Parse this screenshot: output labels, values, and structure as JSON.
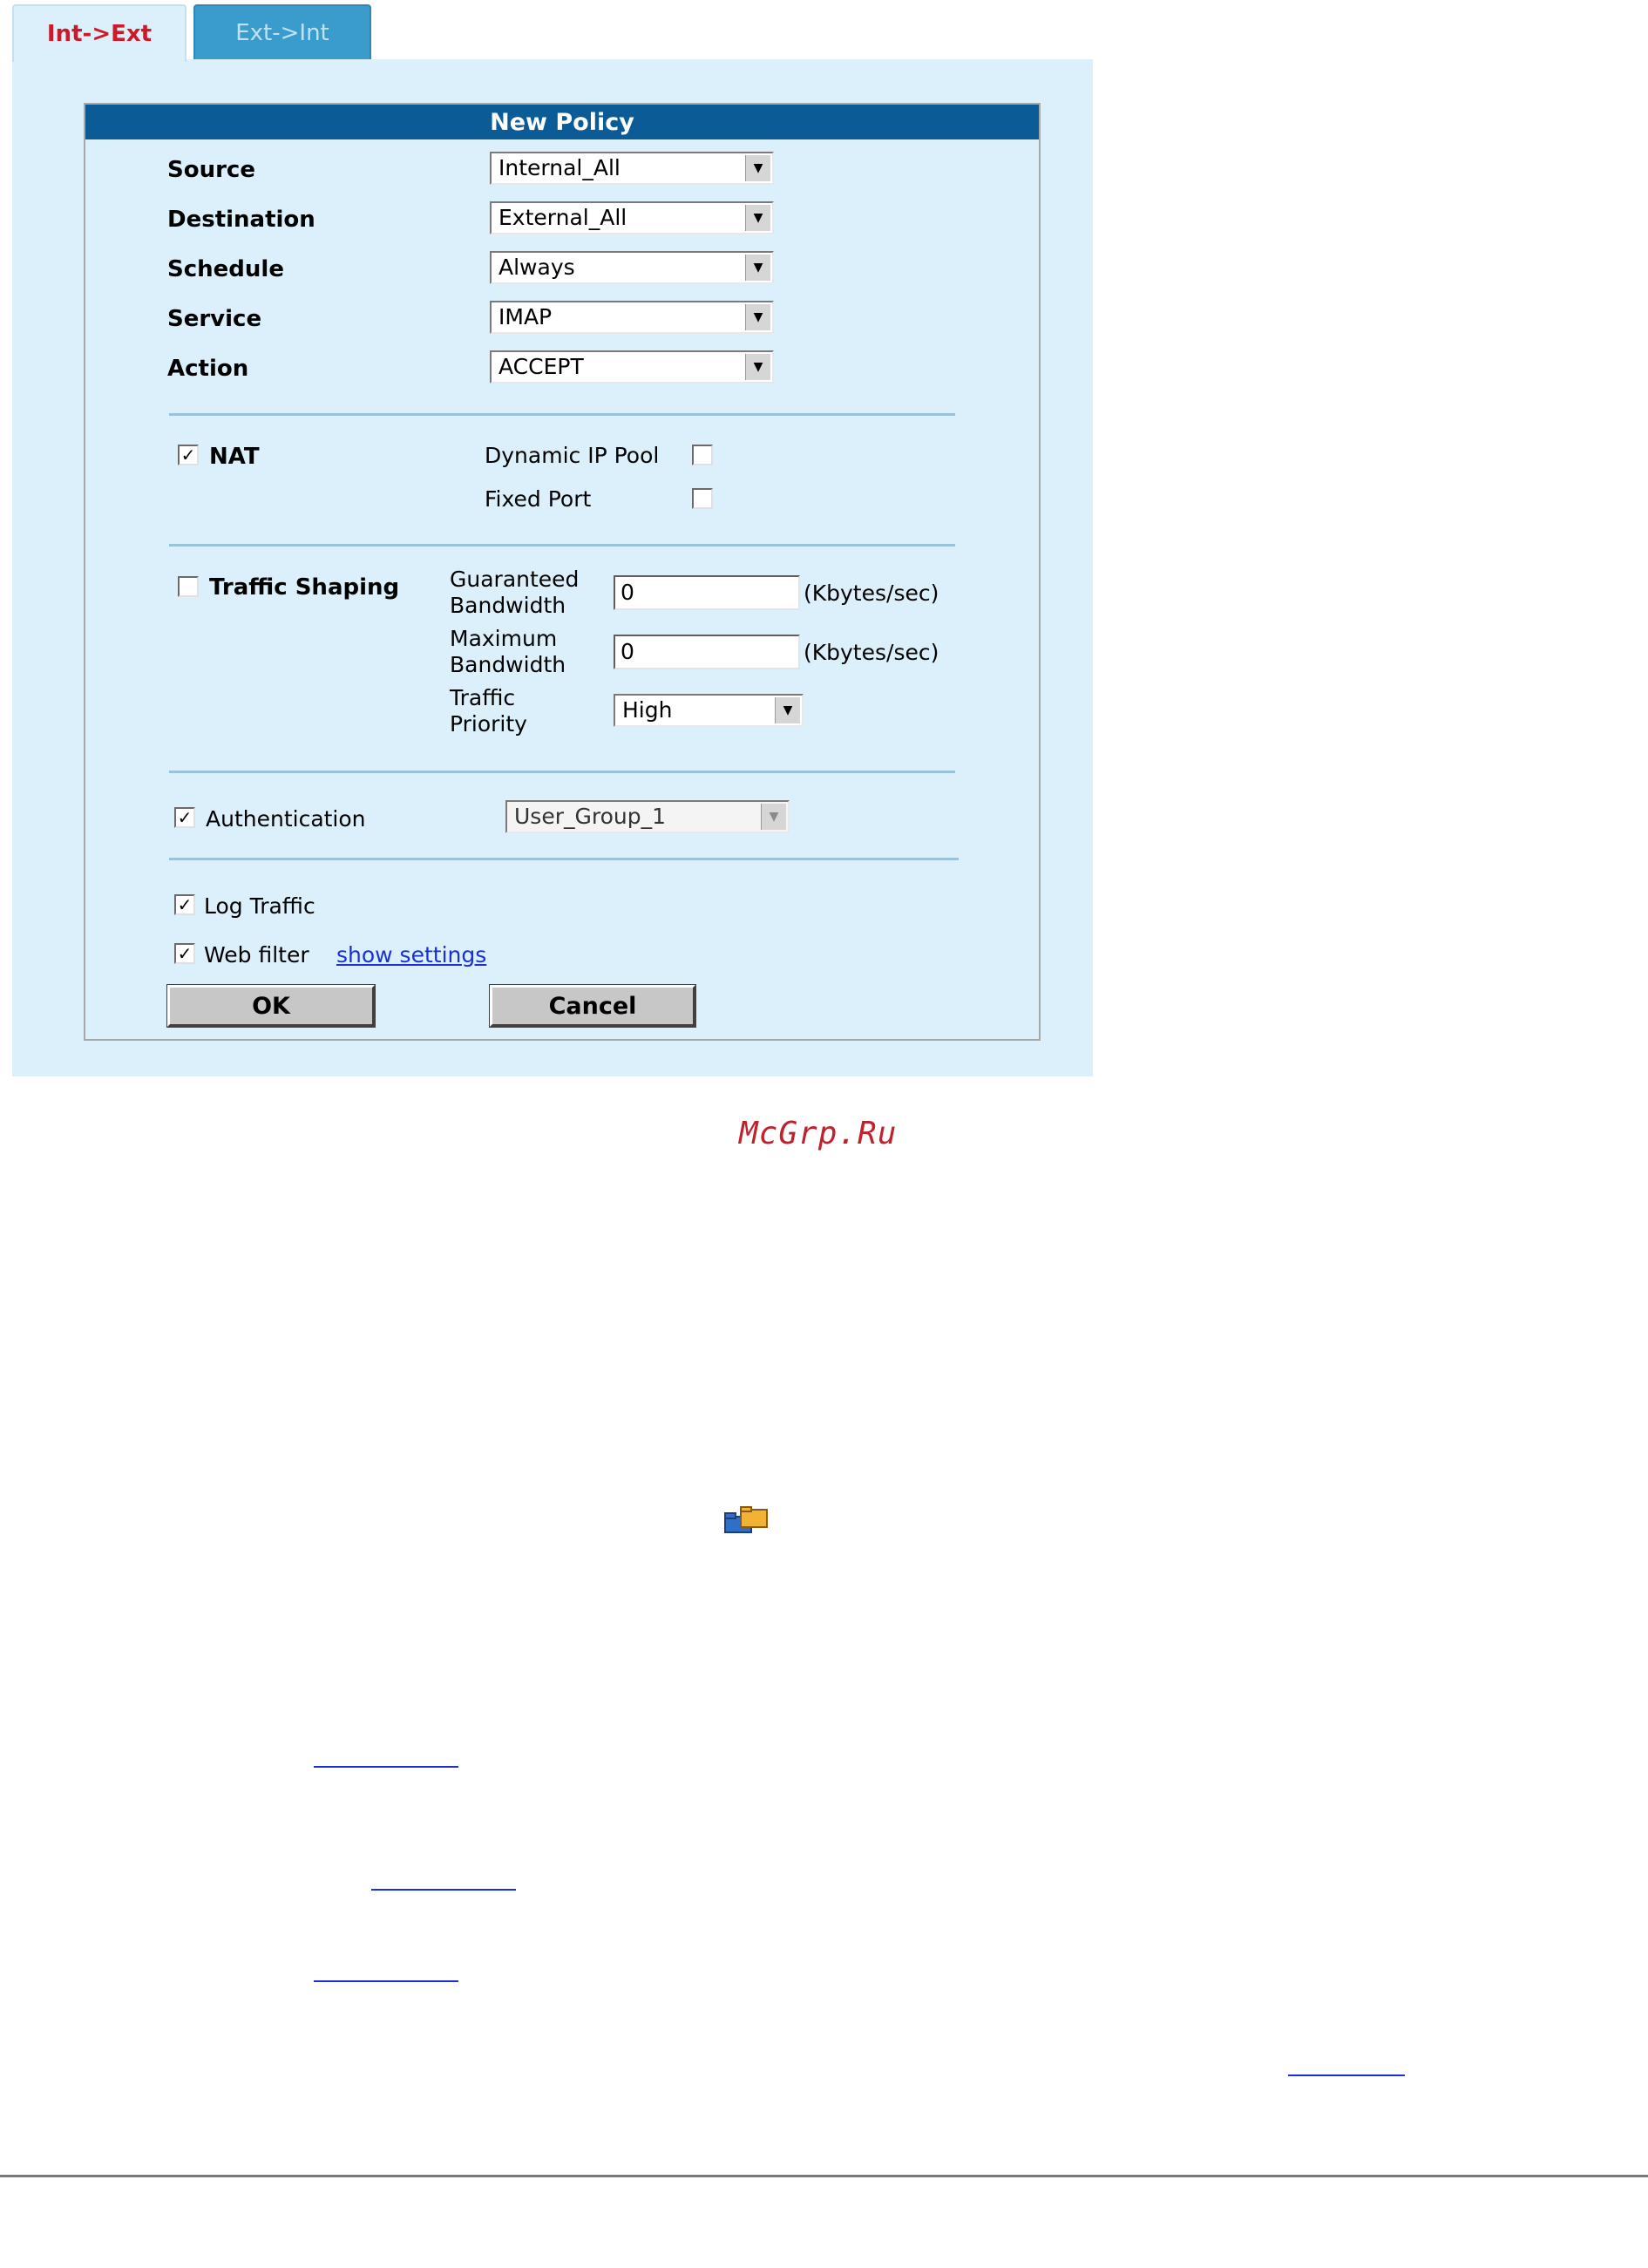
{
  "tabs": [
    {
      "label": "Int->Ext",
      "active": true
    },
    {
      "label": "Ext->Int",
      "active": false
    }
  ],
  "form": {
    "title": "New Policy",
    "fields": {
      "source": {
        "label": "Source",
        "value": "Internal_All"
      },
      "destination": {
        "label": "Destination",
        "value": "External_All"
      },
      "schedule": {
        "label": "Schedule",
        "value": "Always"
      },
      "service": {
        "label": "Service",
        "value": "IMAP"
      },
      "action": {
        "label": "Action",
        "value": "ACCEPT"
      }
    },
    "nat": {
      "label": "NAT",
      "checked": true,
      "dynamic_ip_pool": {
        "label": "Dynamic IP Pool",
        "checked": false
      },
      "fixed_port": {
        "label": "Fixed Port",
        "checked": false
      }
    },
    "traffic_shaping": {
      "label": "Traffic Shaping",
      "checked": false,
      "guaranteed_label_1": "Guaranteed",
      "guaranteed_label_2": "Bandwidth",
      "guaranteed_value": "0",
      "maximum_label_1": "Maximum",
      "maximum_label_2": "Bandwidth",
      "maximum_value": "0",
      "unit": "(Kbytes/sec)",
      "priority_label_1": "Traffic",
      "priority_label_2": "Priority",
      "priority_value": "High"
    },
    "authentication": {
      "label": "Authentication",
      "checked": true,
      "value": "User_Group_1"
    },
    "log_traffic": {
      "label": "Log Traffic",
      "checked": true
    },
    "web_filter": {
      "label": "Web filter",
      "checked": true,
      "link": "show settings"
    },
    "ok_label": "OK",
    "cancel_label": "Cancel"
  },
  "watermark": "McGrp.Ru",
  "icons": {
    "folder": "folder-multiple-icon"
  },
  "colors": {
    "header": "#0b5b96",
    "panel": "#dcf0fb",
    "active_tab_text": "#cc1a2a",
    "inactive_tab": "#3a9ccd",
    "link": "#1a2fd8"
  }
}
